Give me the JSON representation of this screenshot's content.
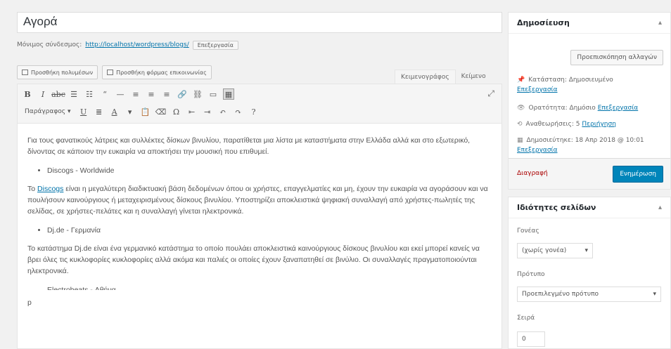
{
  "title": "Αγορά",
  "permalink": {
    "label": "Μόνιμος σύνδεσμος:",
    "url": "http://localhost/wordpress/blogs/",
    "edit_label": "Επεξεργασία"
  },
  "media": {
    "add_media": "Προσθήκη πολυμέσων",
    "add_form": "Προσθήκη φόρμας επικοινωνίας"
  },
  "tabs": [
    "Κειμενογράφος",
    "Κείμενο"
  ],
  "toolbar": {
    "format_select": "Παράγραφος"
  },
  "content": {
    "p1": "Για τους φανατικούς λάτρεις και συλλέκτες δίσκων βινυλίου, παρατίθεται μια λίστα με καταστήματα στην Ελλάδα αλλά και στο εξωτερικό, δίνοντας σε κάποιον την ευκαιρία να αποκτήσει την μουσική που επιθυμεί.",
    "li1": "Discogs - Worldwide",
    "p2_link": "Discogs",
    "p2_intro": "Το ",
    "p2": " είναι η μεγαλύτερη διαδικτυακή βάση δεδομένων όπου οι χρήστες, επαγγελματίες και μη, έχουν την ευκαιρία να αγοράσουν και να πουλήσουν καινούργιους ή μεταχειρισμένους δίσκους βινυλίου. Υποστηρίζει αποκλειστικά ψηφιακή συναλλαγή από χρήστες-πωλητές της σελίδας, σε χρήστες-πελάτες και η συναλλαγή γίνεται ηλεκτρονικά.",
    "li2": "Dj.de - Γερμανία",
    "p3": "Το κατάστημα Dj.de είναι ένα γερμανικό κατάστημα το οποίο πουλάει αποκλειστικά καινούργιους δίσκους βινυλίου και εκεί μπορεί κανείς να βρει όλες τις κυκλοφορίες κυκλοφορίες αλλά ακόμα και παλιές οι οποίες έχουν ξαναπατηθεί σε βινύλιο. Οι συναλλαγές πραγματοποιούνται ηλεκτρονικά.",
    "li3": "Electrobeats - Αθήνα",
    "footer_char": "p"
  },
  "publish": {
    "heading": "Δημοσίευση",
    "preview": "Προεπισκόπηση αλλαγών",
    "status_label": "Κατάσταση: Δημοσιευμένο",
    "status_edit": "Επεξεργασία",
    "visibility_label": "Ορατότητα: Δημόσιο",
    "visibility_edit": "Επεξεργασία",
    "revisions_label": "Αναθεωρήσεις: 5",
    "revisions_link": "Περιήγηση",
    "published_label": "Δημοσιεύτηκε: 18 Απρ 2018 @ 10:01",
    "published_edit": "Επεξεργασία",
    "trash": "Διαγραφή",
    "update": "Ενημέρωση"
  },
  "attributes": {
    "heading": "Ιδιότητες σελίδων",
    "parent_label": "Γονέας",
    "parent_value": "(χωρίς γονέα)",
    "template_label": "Πρότυπο",
    "template_value": "Προεπιλεγμένο πρότυπο",
    "order_label": "Σειρά",
    "order_value": "0"
  }
}
